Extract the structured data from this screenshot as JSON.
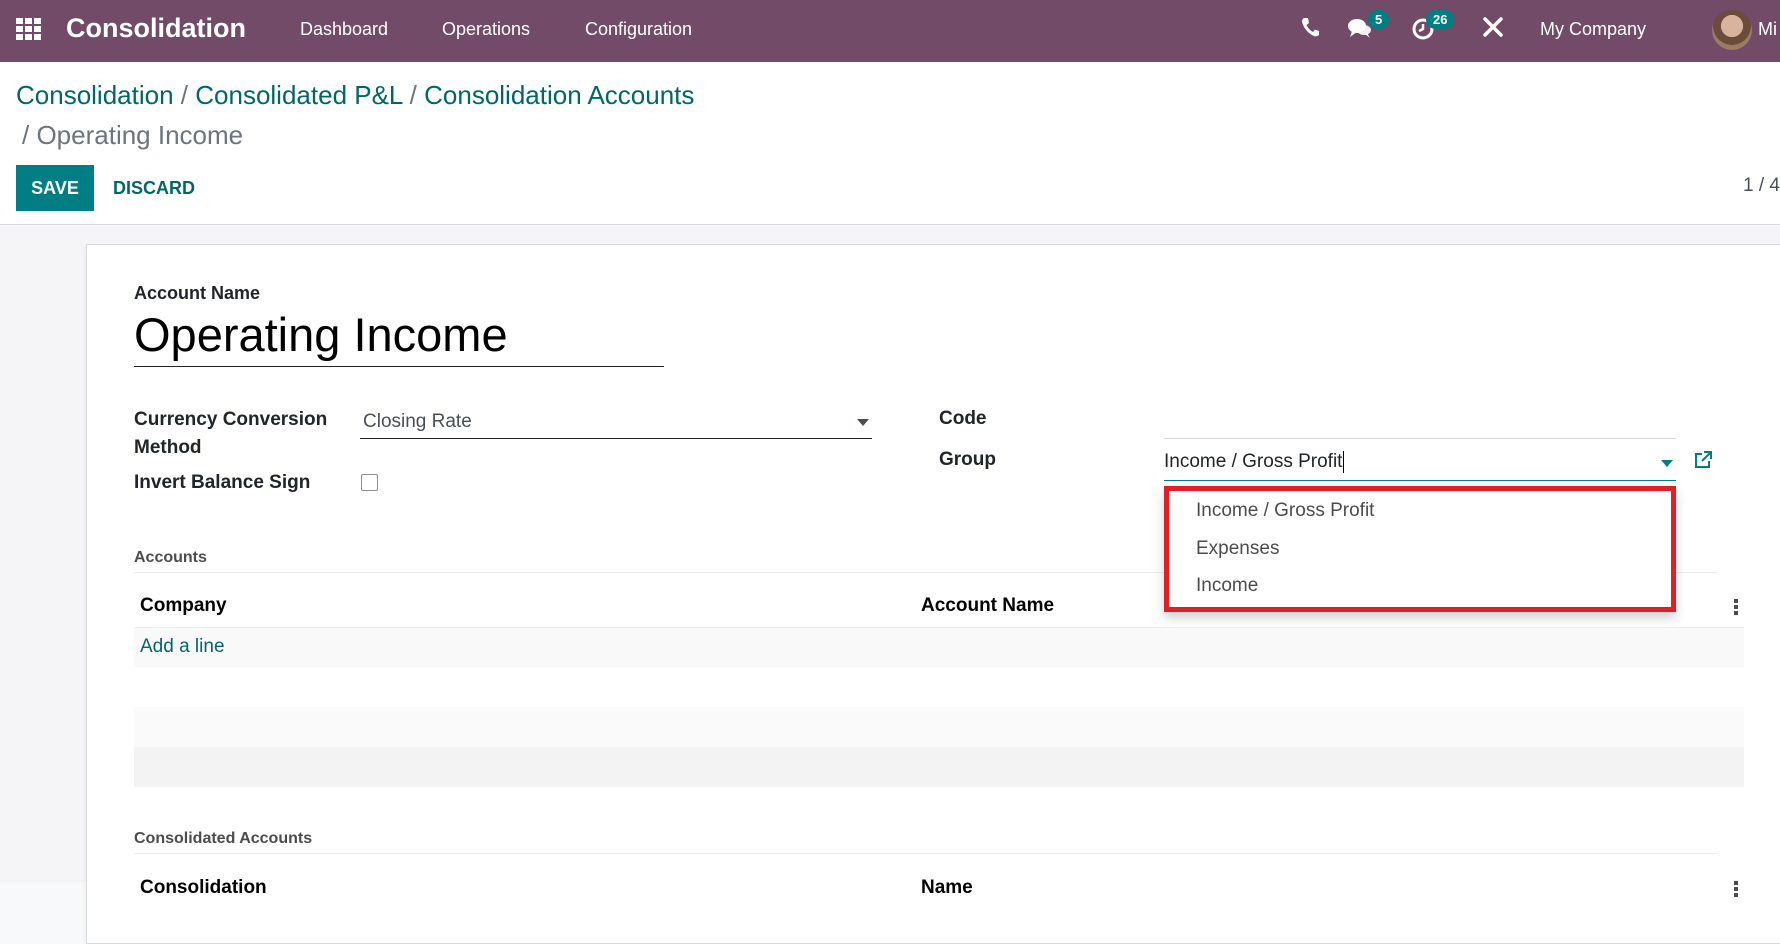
{
  "navbar": {
    "app_name": "Consolidation",
    "menus": [
      "Dashboard",
      "Operations",
      "Configuration"
    ],
    "icons": [
      "apps-grid-icon",
      "phone-icon",
      "chat-icon",
      "activity-clock-icon",
      "debug-tools-icon"
    ],
    "messages_badge": "5",
    "activities_badge": "26",
    "company": "My Company",
    "user_name_partial": "Mi"
  },
  "breadcrumb": {
    "items": [
      "Consolidation",
      "Consolidated P&L",
      "Consolidation Accounts"
    ],
    "current": "Operating Income",
    "separator": "/"
  },
  "buttons": {
    "save": "SAVE",
    "discard": "DISCARD"
  },
  "pager": "1 / 4",
  "form": {
    "account_name_label": "Account Name",
    "account_name_value": "Operating Income",
    "currency_label_line1": "Currency Conversion",
    "currency_label_line2": "Method",
    "currency_value": "Closing Rate",
    "invert_label": "Invert Balance Sign",
    "invert_checked": false,
    "code_label": "Code",
    "code_value": "",
    "group_label": "Group",
    "group_value": "Income / Gross Profit",
    "group_options": [
      "Income / Gross Profit",
      "Expenses",
      "Income"
    ],
    "accent_highlight_color": "#e21f26"
  },
  "accounts_section": {
    "title": "Accounts",
    "columns": [
      "Company",
      "Account Name"
    ],
    "add_line": "Add a line"
  },
  "consolidated_section": {
    "title": "Consolidated Accounts",
    "columns": [
      "Consolidation",
      "Name"
    ]
  }
}
